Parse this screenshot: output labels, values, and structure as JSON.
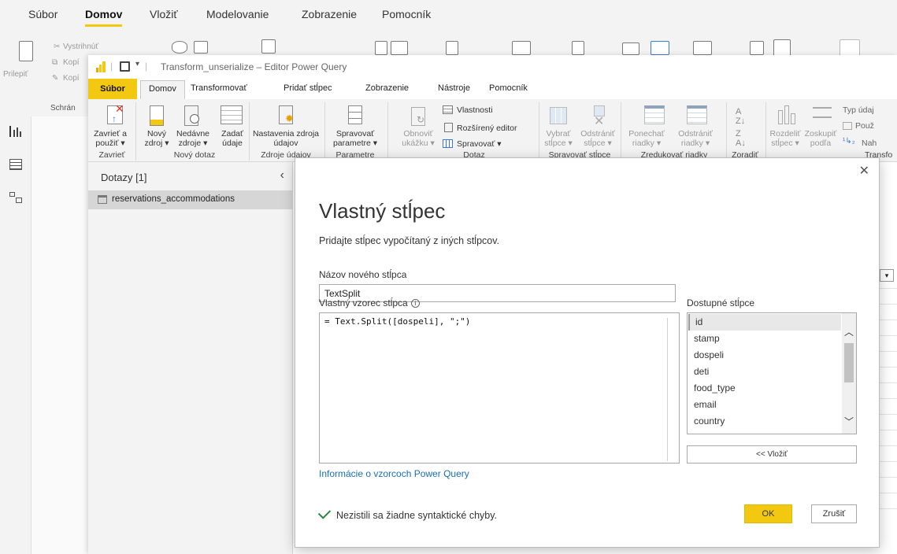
{
  "outer": {
    "tabs": [
      "Súbor",
      "Domov",
      "Vložiť",
      "Modelovanie",
      "Zobrazenie",
      "Pomocník"
    ],
    "active_tab": "Domov",
    "clipboard": {
      "paste": "Prilepiť",
      "cut": "Vystrihnúť",
      "copy": "Kopí",
      "format_copy": "Kopí",
      "group": "Schrán"
    }
  },
  "pq": {
    "window_title": "Transform_unserialize – Editor Power Query",
    "tabs": [
      "Súbor",
      "Domov",
      "Transformovať",
      "Pridať stĺpec",
      "Zobrazenie",
      "Nástroje",
      "Pomocník"
    ],
    "active_tab": "Domov",
    "ribbon": {
      "close_apply": "Zavrieť a použiť ▾",
      "group_close": "Zavrieť",
      "new_source": "Nový zdroj ▾",
      "recent_sources": "Nedávne zdroje ▾",
      "enter_data": "Zadať údaje",
      "group_new_query": "Nový dotaz",
      "data_source_settings": "Nastavenia zdroja údajov",
      "group_data_sources": "Zdroje údajov",
      "manage_params": "Spravovať parametre ▾",
      "group_params": "Parametre",
      "refresh_preview": "Obnoviť ukážku ▾",
      "properties": "Vlastnosti",
      "advanced_editor": "Rozšírený editor",
      "manage": "Spravovať ▾",
      "group_query": "Dotaz",
      "choose_columns": "Vybrať stĺpce ▾",
      "remove_columns": "Odstrániť stĺpce ▾",
      "group_manage_columns": "Spravovať stĺpce",
      "keep_rows": "Ponechať riadky ▾",
      "remove_rows": "Odstrániť riadky ▾",
      "group_reduce_rows": "Zredukovať riadky",
      "group_sort": "Zoradiť",
      "split_column": "Rozdeliť stĺpec ▾",
      "group_by": "Zoskupiť podľa",
      "data_type": "Typ údaj",
      "use_first_row": "Použ",
      "replace_values": "Nah",
      "group_transform": "Transfo"
    },
    "queries": {
      "header": "Dotazy [1]",
      "items": [
        "reservations_accommodations"
      ]
    }
  },
  "dialog": {
    "title": "Vlastný stĺpec",
    "subtitle": "Pridajte stĺpec vypočítaný z iných stĺpcov.",
    "name_label": "Názov nového stĺpca",
    "name_value": "TextSplit",
    "formula_label": "Vlastný vzorec stĺpca",
    "formula_value": "= Text.Split([dospeli], \";\")",
    "columns_label": "Dostupné stĺpce",
    "columns": [
      "id",
      "stamp",
      "dospeli",
      "deti",
      "food_type",
      "email",
      "country"
    ],
    "selected_column": "id",
    "insert_button": "<< Vložiť",
    "info_link": "Informácie o vzorcoch Power Query",
    "status": "Nezistili sa žiadne syntaktické chyby.",
    "ok": "OK",
    "cancel": "Zrušiť",
    "colors": {
      "accent": "#f2c811",
      "success": "#2e8540",
      "link": "#1a6fb5"
    }
  }
}
